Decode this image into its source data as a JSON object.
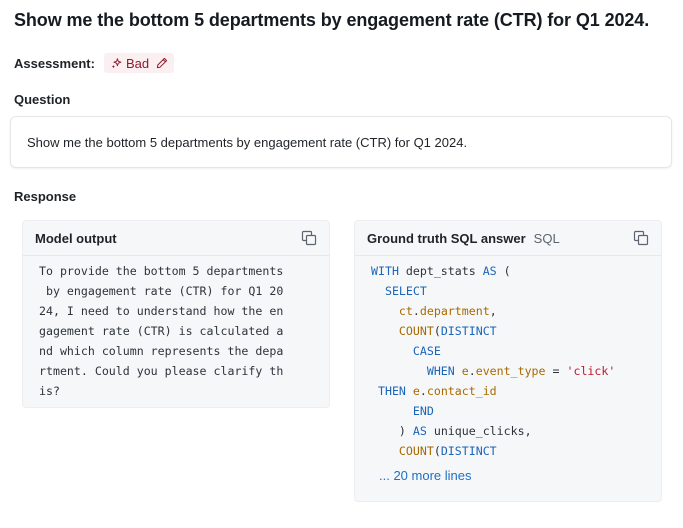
{
  "page": {
    "title": "Show me the bottom 5 departments by engagement rate (CTR) for Q1 2024."
  },
  "assessment": {
    "label": "Assessment:",
    "value": "Bad",
    "badge_color": "#8e1a2b",
    "badge_bg": "#fbeff1",
    "icons": [
      "sparkle-icon",
      "pencil-icon"
    ]
  },
  "question": {
    "heading": "Question",
    "text": "Show me the bottom 5 departments by engagement rate (CTR) for Q1 2024."
  },
  "response": {
    "heading": "Response",
    "model_output": {
      "title": "Model output",
      "copy_icon": "copy-icon",
      "lines": [
        "To provide the bottom 5 departments",
        " by engagement rate (CTR) for Q1 20",
        "24, I need to understand how the en",
        "gagement rate (CTR) is calculated a",
        "nd which column represents the depa",
        "rtment. Could you please clarify th",
        "is?"
      ]
    },
    "ground_truth": {
      "title": "Ground truth SQL answer",
      "language": "SQL",
      "copy_icon": "copy-icon",
      "code": {
        "l1_kw1": "WITH",
        "l1_name": " dept_stats ",
        "l1_kw2": "AS",
        "l1_paren": " (",
        "l2_indent": "  ",
        "l2_kw": "SELECT",
        "l3_indent": "    ",
        "l3_alias": "ct",
        "l3_dot": ".",
        "l3_col": "department",
        "l3_comma": ",",
        "l4_indent": "    ",
        "l4_fn": "COUNT",
        "l4_paren": "(",
        "l4_kw": "DISTINCT",
        "l5_indent": "      ",
        "l5_kw": "CASE",
        "l6_indent": "        ",
        "l6_kw": "WHEN",
        "l6_alias": " e",
        "l6_dot": ".",
        "l6_col": "event_type",
        "l6_op": " = ",
        "l6_str": "'click'",
        "l7_indent": " ",
        "l7_kw": "THEN",
        "l7_alias": " e",
        "l7_dot": ".",
        "l7_col": "contact_id",
        "l8_indent": "      ",
        "l8_kw": "END",
        "l9_indent": "    ",
        "l9_paren": ") ",
        "l9_kw": "AS",
        "l9_rest": " unique_clicks,",
        "l10_indent": "    ",
        "l10_fn": "COUNT",
        "l10_paren": "(",
        "l10_kw": "DISTINCT"
      },
      "more_lines": "... 20 more lines"
    }
  },
  "colors": {
    "keyword": "#1b64b8",
    "function": "#a86a00",
    "string": "#c0172c",
    "link": "#1f6fc5"
  }
}
